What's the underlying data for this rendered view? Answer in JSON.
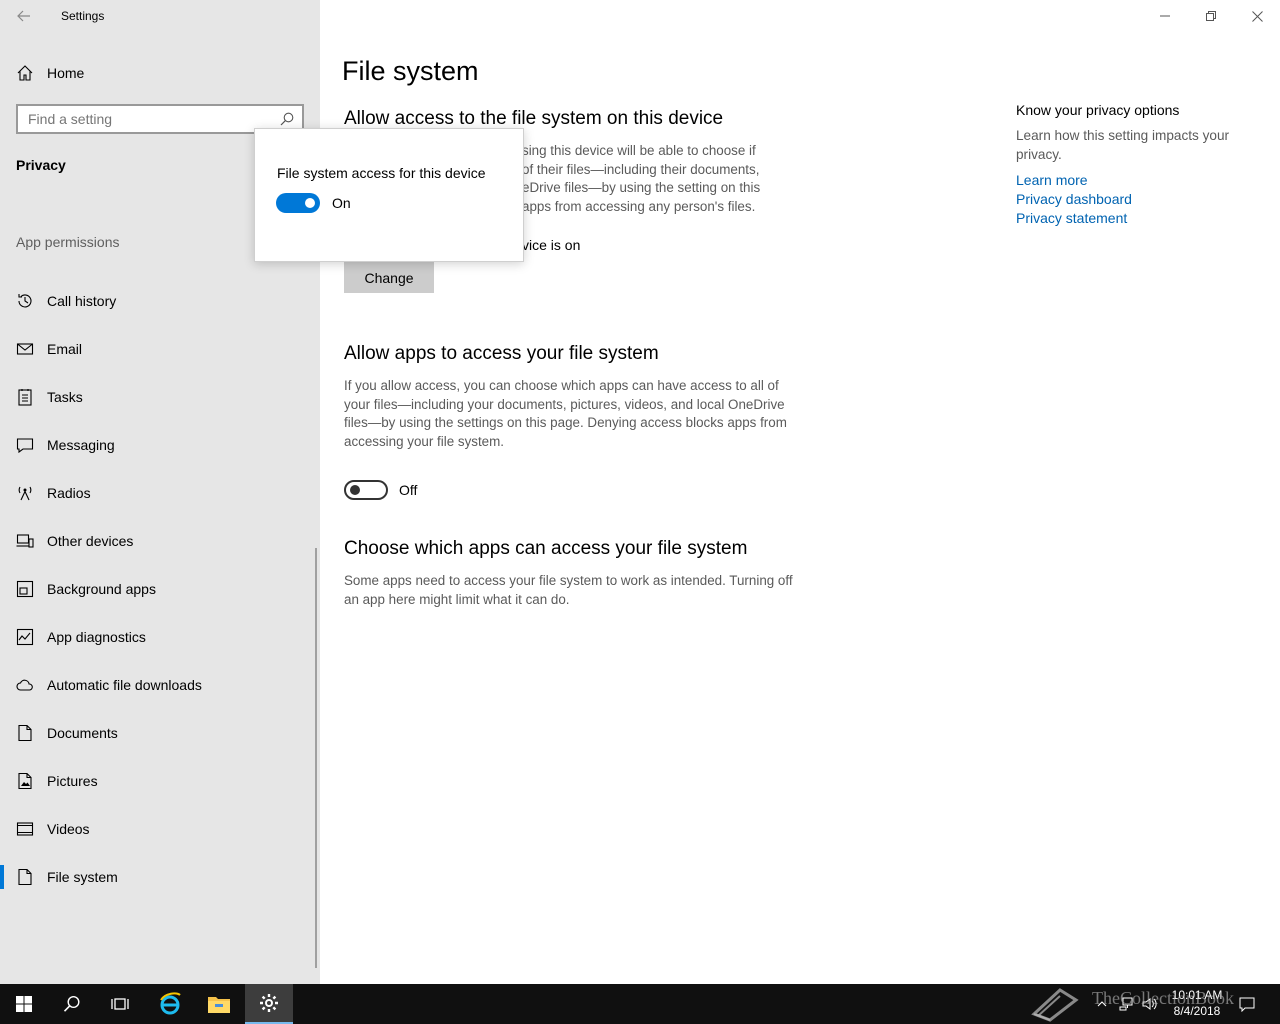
{
  "window": {
    "app_title": "Settings"
  },
  "sidebar": {
    "home_label": "Home",
    "search_placeholder": "Find a setting",
    "section_title": "Privacy",
    "group_title": "App permissions",
    "items": [
      {
        "label": "Call history",
        "icon": "history-icon"
      },
      {
        "label": "Email",
        "icon": "mail-icon"
      },
      {
        "label": "Tasks",
        "icon": "tasks-icon"
      },
      {
        "label": "Messaging",
        "icon": "chat-icon"
      },
      {
        "label": "Radios",
        "icon": "radio-tower-icon"
      },
      {
        "label": "Other devices",
        "icon": "devices-icon"
      },
      {
        "label": "Background apps",
        "icon": "background-apps-icon"
      },
      {
        "label": "App diagnostics",
        "icon": "diagnostics-icon"
      },
      {
        "label": "Automatic file downloads",
        "icon": "cloud-icon"
      },
      {
        "label": "Documents",
        "icon": "document-icon"
      },
      {
        "label": "Pictures",
        "icon": "picture-icon"
      },
      {
        "label": "Videos",
        "icon": "video-icon"
      },
      {
        "label": "File system",
        "icon": "file-icon",
        "active": true
      }
    ]
  },
  "main": {
    "page_title": "File system",
    "section1": {
      "heading": "Allow access to the file system on this device",
      "desc_line1": "sing this device will be able to choose if",
      "desc_line2": "of their files—including their documents,",
      "desc_line3": "eDrive files—by using the setting on this",
      "desc_line4": "apps from accessing any person's files.",
      "status": "vice is on",
      "change_label": "Change"
    },
    "section2": {
      "heading": "Allow apps to access your file system",
      "description": "If you allow access, you can choose which apps can have access to all of your files—including your documents, pictures, videos, and local OneDrive files—by using the settings on this page. Denying access blocks apps from accessing your file system.",
      "toggle_label": "Off",
      "toggle_on": false
    },
    "section3": {
      "heading": "Choose which apps can access your file system",
      "description": "Some apps need to access your file system to work as intended. Turning off an app here might limit what it can do."
    }
  },
  "right": {
    "heading": "Know your privacy options",
    "description": "Learn how this setting impacts your privacy.",
    "links": [
      "Learn more",
      "Privacy dashboard",
      "Privacy statement"
    ]
  },
  "flyout": {
    "title": "File system access for this device",
    "toggle_label": "On",
    "toggle_on": true
  },
  "taskbar": {
    "time": "10:01 AM",
    "date": "8/4/2018",
    "watermark": "TheCollectionBook"
  },
  "colors": {
    "accent": "#0078d7",
    "link": "#0063b1",
    "sidebar_bg": "#e6e6e6",
    "taskbar_bg": "#101010"
  }
}
